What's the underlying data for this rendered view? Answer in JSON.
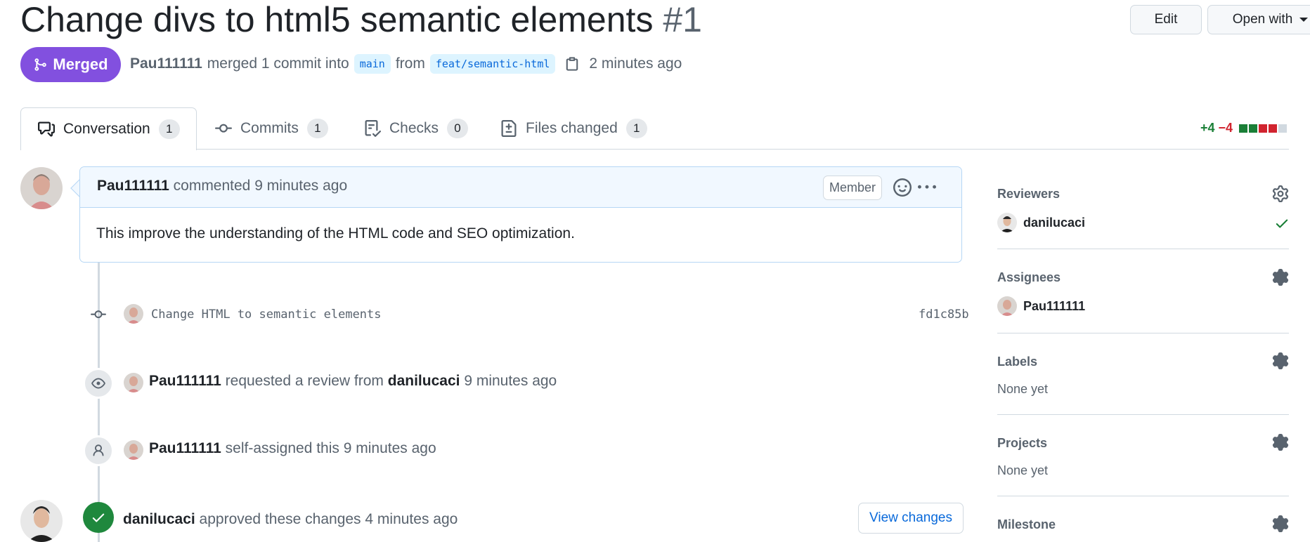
{
  "header": {
    "title": "Change divs to html5 semantic elements",
    "number": "#1",
    "edit_label": "Edit",
    "open_with_label": "Open with"
  },
  "status": {
    "badge_label": "Merged",
    "author": "Pau111111",
    "action_text": "merged 1 commit into",
    "base_branch": "main",
    "from_text": "from",
    "head_branch": "feat/semantic-html",
    "time": "2 minutes ago"
  },
  "tabs": [
    {
      "label": "Conversation",
      "count": "1"
    },
    {
      "label": "Commits",
      "count": "1"
    },
    {
      "label": "Checks",
      "count": "0"
    },
    {
      "label": "Files changed",
      "count": "1"
    }
  ],
  "diffstat": {
    "additions": "+4",
    "deletions": "−4"
  },
  "comment": {
    "author": "Pau111111",
    "action": "commented",
    "time": "9 minutes ago",
    "role": "Member",
    "body": "This improve the understanding of the HTML code and SEO optimization."
  },
  "timeline": {
    "commit": {
      "message": "Change HTML to semantic elements",
      "sha": "fd1c85b"
    },
    "review_request": {
      "actor": "Pau111111",
      "text": "requested a review from",
      "target": "danilucaci",
      "time": "9 minutes ago"
    },
    "assign": {
      "actor": "Pau111111",
      "text": "self-assigned this",
      "time": "9 minutes ago"
    },
    "approval": {
      "actor": "danilucaci",
      "text": "approved these changes",
      "time": "4 minutes ago",
      "button_label": "View changes"
    }
  },
  "sidebar": {
    "reviewers": {
      "title": "Reviewers",
      "user": "danilucaci"
    },
    "assignees": {
      "title": "Assignees",
      "user": "Pau111111"
    },
    "labels": {
      "title": "Labels",
      "value": "None yet"
    },
    "projects": {
      "title": "Projects",
      "value": "None yet"
    },
    "milestone": {
      "title": "Milestone"
    }
  },
  "colors": {
    "merged": "#8250df",
    "link": "#0969da",
    "success": "#1a7f37",
    "danger": "#d1242f"
  }
}
